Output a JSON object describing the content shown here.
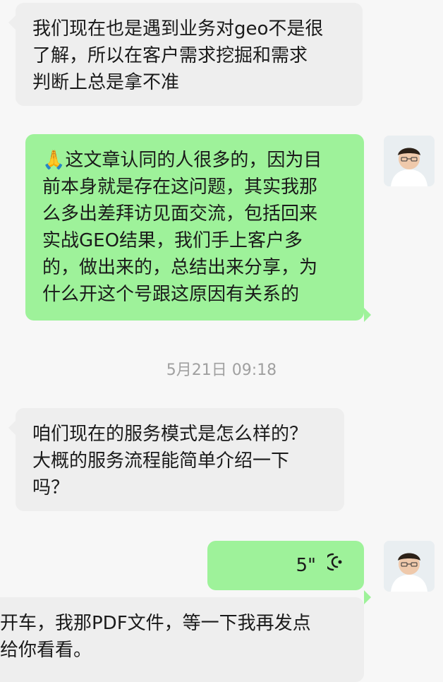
{
  "chat": {
    "messages": [
      {
        "id": "m1",
        "side": "in",
        "lines": [
          "我们现在也是遇到业务对geo不是很",
          "了解，所以在客户需求挖掘和需求",
          "判断上总是拿不准"
        ]
      },
      {
        "id": "m2",
        "side": "out",
        "emoji": "🙏",
        "lines": [
          "这文章认同的人很多的，因为目",
          "前本身就是存在这问题，其实我那",
          "么多出差拜访见面交流，包括回来",
          "实战GEO结果，我们手上客户多",
          "的，做出来的，总结出来分享，为",
          "什么开这个号跟这原因有关系的"
        ]
      },
      {
        "id": "m3",
        "side": "in",
        "lines": [
          "咱们现在的服务模式是怎么样的？",
          "大概的服务流程能简单介绍一下",
          "吗？"
        ]
      },
      {
        "id": "m4",
        "side": "out",
        "type": "voice",
        "duration": "5\""
      },
      {
        "id": "m5",
        "side": "in",
        "lines": [
          "开车，我那PDF文件，等一下我再发点",
          "给你看看。"
        ]
      }
    ],
    "timestamp": "5月21日 09:18"
  },
  "icons": {
    "voice": "voice-wave-icon",
    "avatar": "user-avatar-icon",
    "emoji": "clapping-hands-icon"
  },
  "colors": {
    "background": "#f7f7f7",
    "incoming_bubble": "#eeeeee",
    "outgoing_bubble": "#9ef29a",
    "timestamp_text": "#a0a0a0"
  }
}
